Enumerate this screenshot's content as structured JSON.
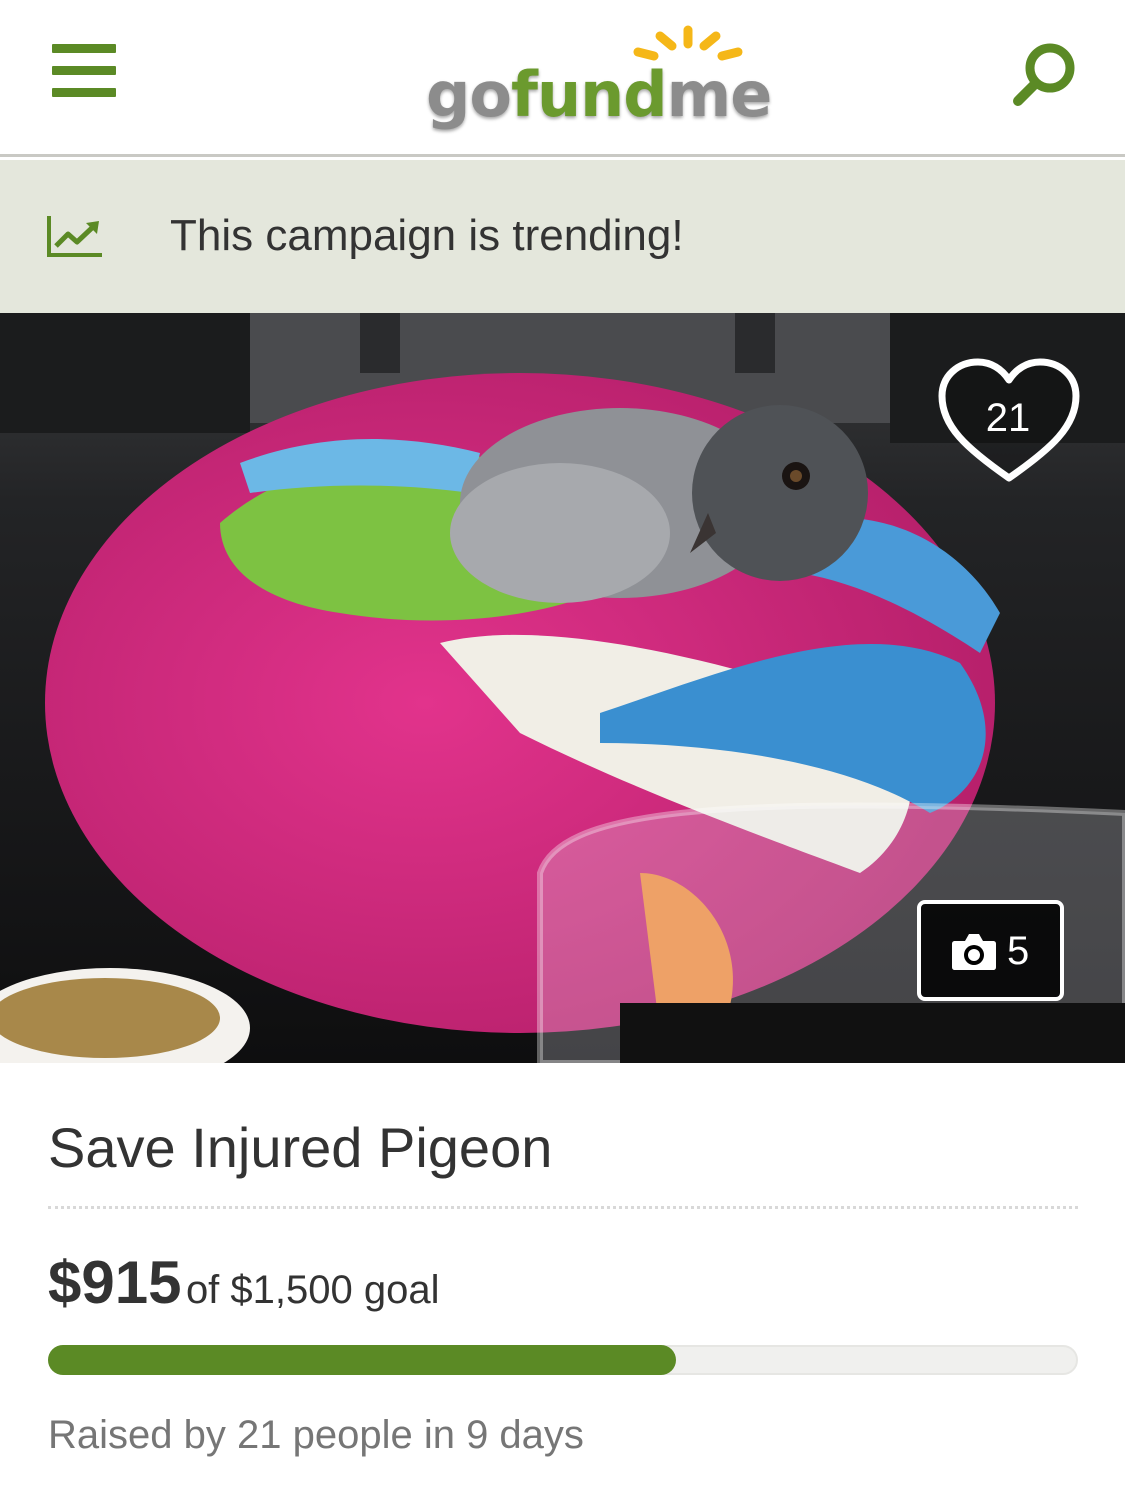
{
  "header": {
    "logo": {
      "part1": "go",
      "part2": "fund",
      "part3": "me"
    },
    "menu_icon": "hamburger-menu-icon",
    "search_icon": "search-icon",
    "accent_color": "#5b8a25"
  },
  "trending": {
    "icon": "trending-chart-icon",
    "text": "This campaign is trending!"
  },
  "photo": {
    "heart_icon": "heart-icon",
    "heart_count": "21",
    "camera_icon": "camera-icon",
    "photo_count": "5"
  },
  "campaign": {
    "title": "Save Injured Pigeon",
    "raised_amount": "$915",
    "goal_text": "of $1,500 goal",
    "progress_fraction": 0.61,
    "byline": "Raised by 21 people in 9 days"
  }
}
